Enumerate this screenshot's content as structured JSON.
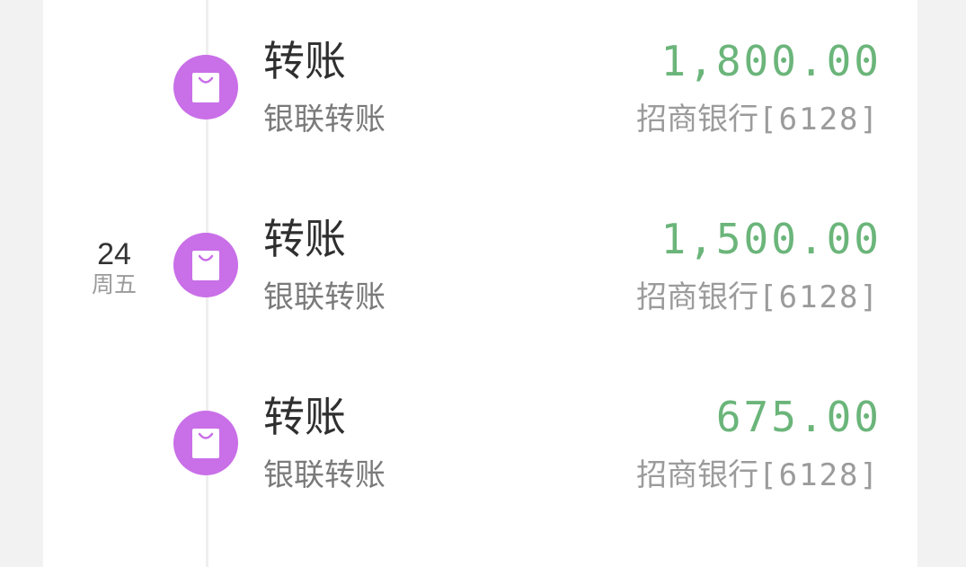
{
  "date_group": {
    "day": "24",
    "weekday": "周五"
  },
  "transactions": [
    {
      "title": "转账",
      "subtitle": "银联转账",
      "amount": "1,800.00",
      "bank": "招商银行",
      "account": "[6128]",
      "icon": "shopping-bag-icon"
    },
    {
      "title": "转账",
      "subtitle": "银联转账",
      "amount": "1,500.00",
      "bank": "招商银行",
      "account": "[6128]",
      "icon": "shopping-bag-icon"
    },
    {
      "title": "转账",
      "subtitle": "银联转账",
      "amount": "675.00",
      "bank": "招商银行",
      "account": "[6128]",
      "icon": "shopping-bag-icon"
    }
  ],
  "colors": {
    "page_background": "#f2f2f2",
    "card_background": "#ffffff",
    "icon_background": "#c96fe8",
    "amount_income": "#6bb57a",
    "title_text": "#2f2f2f",
    "secondary_text": "#9b9b9b"
  }
}
